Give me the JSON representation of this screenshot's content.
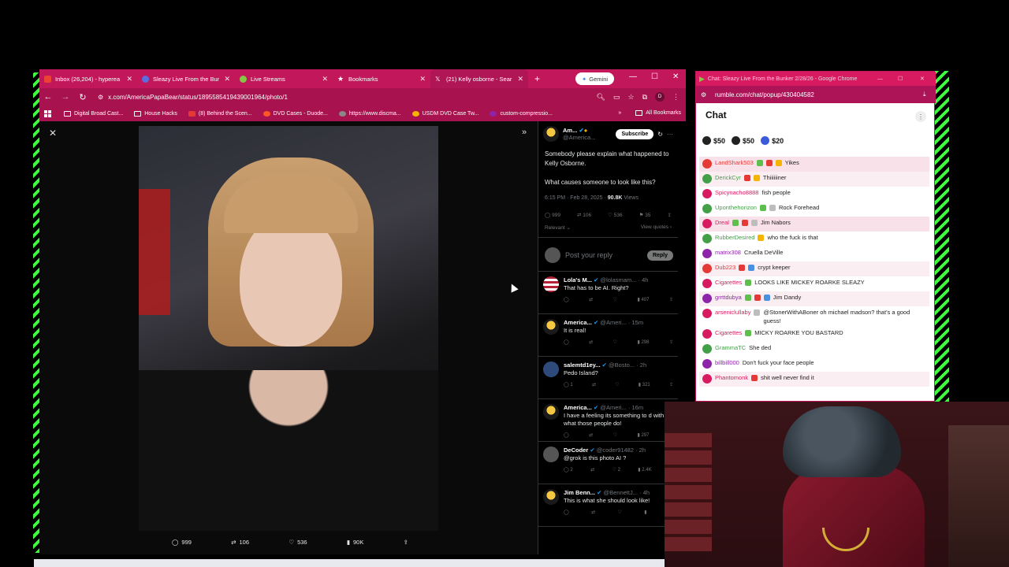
{
  "browser": {
    "tabs": [
      {
        "label": "Inbox (26,204) - hyperea",
        "favicon_color": "#ea4335"
      },
      {
        "label": "Sleazy Live From the Bun",
        "favicon_color": "#5b6ee1"
      },
      {
        "label": "Live Streams",
        "favicon_color": "#85c742"
      },
      {
        "label": "Bookmarks",
        "favicon_color": "#ffffff"
      },
      {
        "label": "(21) Kelly osborne - Sear",
        "favicon_color": "#ffffff"
      }
    ],
    "gemini_label": "Gemini",
    "url": "x.com/AmericaPapaBear/status/1895585419439001964/photo/1",
    "bookmarks": [
      "Digital Broad Cast...",
      "House Hacks",
      "(8) Behind the Scen...",
      "DVD Cases - Duode...",
      "https://www.discma...",
      "USDM DVD Case Tw...",
      "custom-compressio..."
    ],
    "all_bookmarks": "All Bookmarks",
    "profile_initial": "D"
  },
  "viewer": {
    "bottom_actions": {
      "comments": "999",
      "reposts": "106",
      "likes": "536",
      "views": "90K"
    }
  },
  "tweet": {
    "author": "Am...",
    "handle": "@America...",
    "subscribe_label": "Subscribe",
    "text1": "Somebody please explain what happened to Kelly Osborne.",
    "text2": "What causes someone to look like this?",
    "time": "6:15 PM · Feb 28, 2025 · ",
    "views_count": "90.8K",
    "views_label": " Views",
    "stats": {
      "comments": "999",
      "reposts": "106",
      "likes": "536",
      "bookmarks": "35"
    },
    "relevant": "Relevant",
    "view_quotes": "View quotes",
    "reply_placeholder": "Post your reply",
    "reply_button": "Reply",
    "replies": [
      {
        "name": "Lola's M...",
        "handle": "@lolasmam...",
        "time": "· 4h",
        "text": "That has to be AI. Right?",
        "replies": "",
        "reposts": "",
        "likes": "",
        "views": "407",
        "avatar": "flag"
      },
      {
        "name": "America...",
        "handle": "@Ameri...",
        "time": "· 15m",
        "text": "It is real!",
        "replies": "",
        "reposts": "",
        "likes": "",
        "views": "298",
        "avatar": "eagle"
      },
      {
        "name": "salemtd1ey...",
        "handle": "@Bosto...",
        "time": "· 2h",
        "text": "Pedo Island?",
        "replies": "1",
        "reposts": "",
        "likes": "",
        "views": "321",
        "avatar": "salem"
      },
      {
        "name": "America...",
        "handle": "@Ameri...",
        "time": "· 16m",
        "text": "I have a feeling its something to d with what those people do!",
        "replies": "",
        "reposts": "",
        "likes": "",
        "views": "297",
        "avatar": "eagle"
      },
      {
        "name": "DeCoder",
        "handle": "@coder91482",
        "time": "· 2h",
        "text": "@grok is this photo AI ?",
        "replies": "2",
        "reposts": "",
        "likes": "2",
        "views": "2.4K",
        "avatar": "grey"
      },
      {
        "name": "Jim Benn...",
        "handle": "@BennettJ...",
        "time": "· 4h",
        "text": "This is what she should look like!",
        "replies": "",
        "reposts": "",
        "likes": "",
        "views": "",
        "avatar": "eagle"
      }
    ]
  },
  "rumble": {
    "window_title": "Chat: Sleazy Live From the Bunker 2/28/26 - Google Chrome",
    "url": "rumble.com/chat/popup/430404582",
    "chat_header": "Chat",
    "rants": [
      "$50",
      "$50",
      "$20"
    ],
    "messages": [
      {
        "user": "LandShark503",
        "color": "#e53935",
        "badges": [
          "g",
          "r",
          "y"
        ],
        "text": "Yikes",
        "bg": "pink"
      },
      {
        "user": "DerickCyr",
        "color": "#43a047",
        "badges": [
          "r",
          "y"
        ],
        "text": "Thiiiiiiner",
        "bg": "pink2"
      },
      {
        "user": "Spicynacho8888",
        "color": "#d81b60",
        "badges": [],
        "text": "fish people",
        "bg": ""
      },
      {
        "user": "Uponthehorizon",
        "color": "#43a047",
        "badges": [
          "g",
          "gr"
        ],
        "text": "Rock Forehead",
        "bg": ""
      },
      {
        "user": "Dreal",
        "color": "#d81b60",
        "badges": [
          "g",
          "r",
          "gr"
        ],
        "text": "Jim Nabors",
        "bg": "pink"
      },
      {
        "user": "RubberDesired",
        "color": "#43a047",
        "badges": [
          "y"
        ],
        "text": "who the fuck is that",
        "bg": ""
      },
      {
        "user": "matrix308",
        "color": "#8e24aa",
        "badges": [],
        "text": "Cruella DeVille",
        "bg": ""
      },
      {
        "user": "Dub223",
        "color": "#e53935",
        "badges": [
          "r",
          "b"
        ],
        "text": "crypt keeper",
        "bg": "pink2"
      },
      {
        "user": "Cigarettes",
        "color": "#d81b60",
        "badges": [
          "g"
        ],
        "text": "LOOKS LIKE MICKEY ROARKE SLEAZY",
        "bg": ""
      },
      {
        "user": "grrttdubya",
        "color": "#8e24aa",
        "badges": [
          "g",
          "r",
          "b"
        ],
        "text": "Jim Dandy",
        "bg": "pink2"
      },
      {
        "user": "arseniclullaby",
        "color": "#d81b60",
        "badges": [
          "gr"
        ],
        "text": "@StonerWithABoner oh michael madson? that's a good guess!",
        "bg": ""
      },
      {
        "user": "Cigarettes",
        "color": "#d81b60",
        "badges": [
          "g"
        ],
        "text": "MICKY ROARKE YOU BASTARD",
        "bg": ""
      },
      {
        "user": "GrammaTC",
        "color": "#43a047",
        "badges": [],
        "text": "She ded",
        "bg": ""
      },
      {
        "user": "billbill000",
        "color": "#8e24aa",
        "badges": [],
        "text": "Don't fuck your face people",
        "bg": ""
      },
      {
        "user": "Phantomonk",
        "color": "#d81b60",
        "badges": [
          "r"
        ],
        "text": "shit well never find it",
        "bg": "pink2"
      }
    ]
  }
}
